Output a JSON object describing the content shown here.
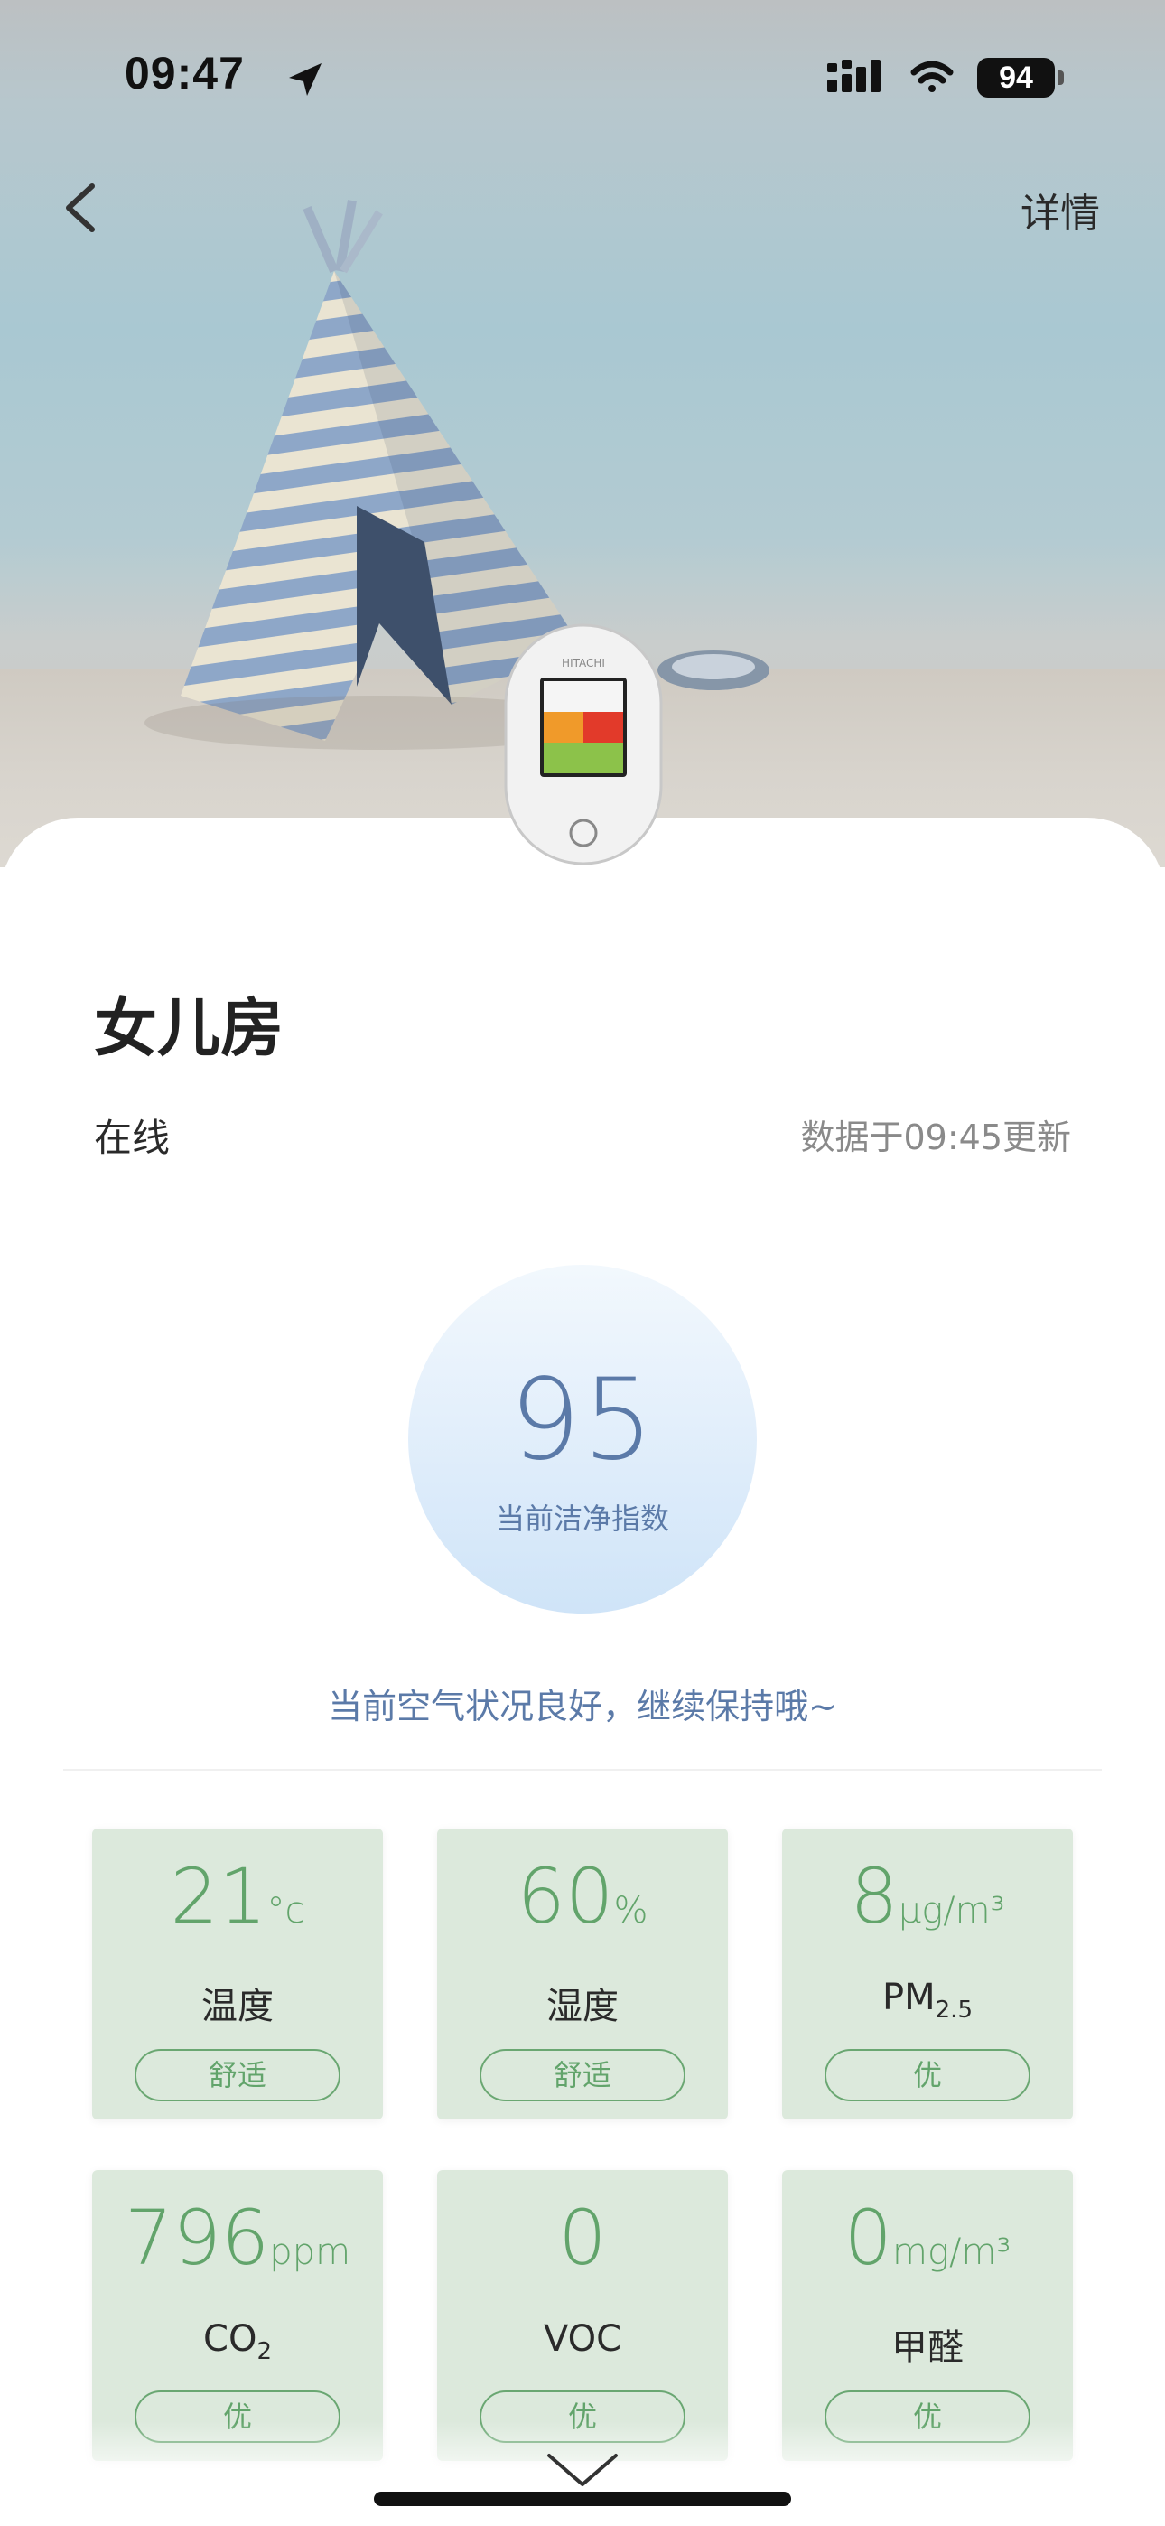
{
  "status_bar": {
    "time": "09:47",
    "battery": "94"
  },
  "nav": {
    "back_icon": "chevron-left-icon",
    "detail_label": "详情"
  },
  "device": {
    "brand": "HITACHI"
  },
  "room": {
    "name": "女儿房",
    "status": "在线",
    "updated": "数据于09:45更新"
  },
  "score": {
    "value": "95",
    "label": "当前洁净指数"
  },
  "message": "当前空气状况良好，继续保持哦~",
  "colors": {
    "accent_blue": "#5b7aa8",
    "tile_bg": "#dce9dc",
    "tile_green": "#62a46b"
  },
  "metrics": [
    {
      "value": "21",
      "unit": "°c",
      "name": "温度",
      "rating": "舒适"
    },
    {
      "value": "60",
      "unit": "%",
      "name": "湿度",
      "rating": "舒适"
    },
    {
      "value": "8",
      "unit": "μg/m³",
      "name": "PM",
      "name_sub": "2.5",
      "rating": "优"
    },
    {
      "value": "796",
      "unit": "ppm",
      "name": "CO",
      "name_sub": "2",
      "rating": "优"
    },
    {
      "value": "0",
      "unit": "",
      "name": "VOC",
      "rating": "优"
    },
    {
      "value": "0",
      "unit": "mg/m³",
      "name": "甲醛",
      "rating": "优"
    }
  ],
  "more_icon": "chevron-down-icon"
}
